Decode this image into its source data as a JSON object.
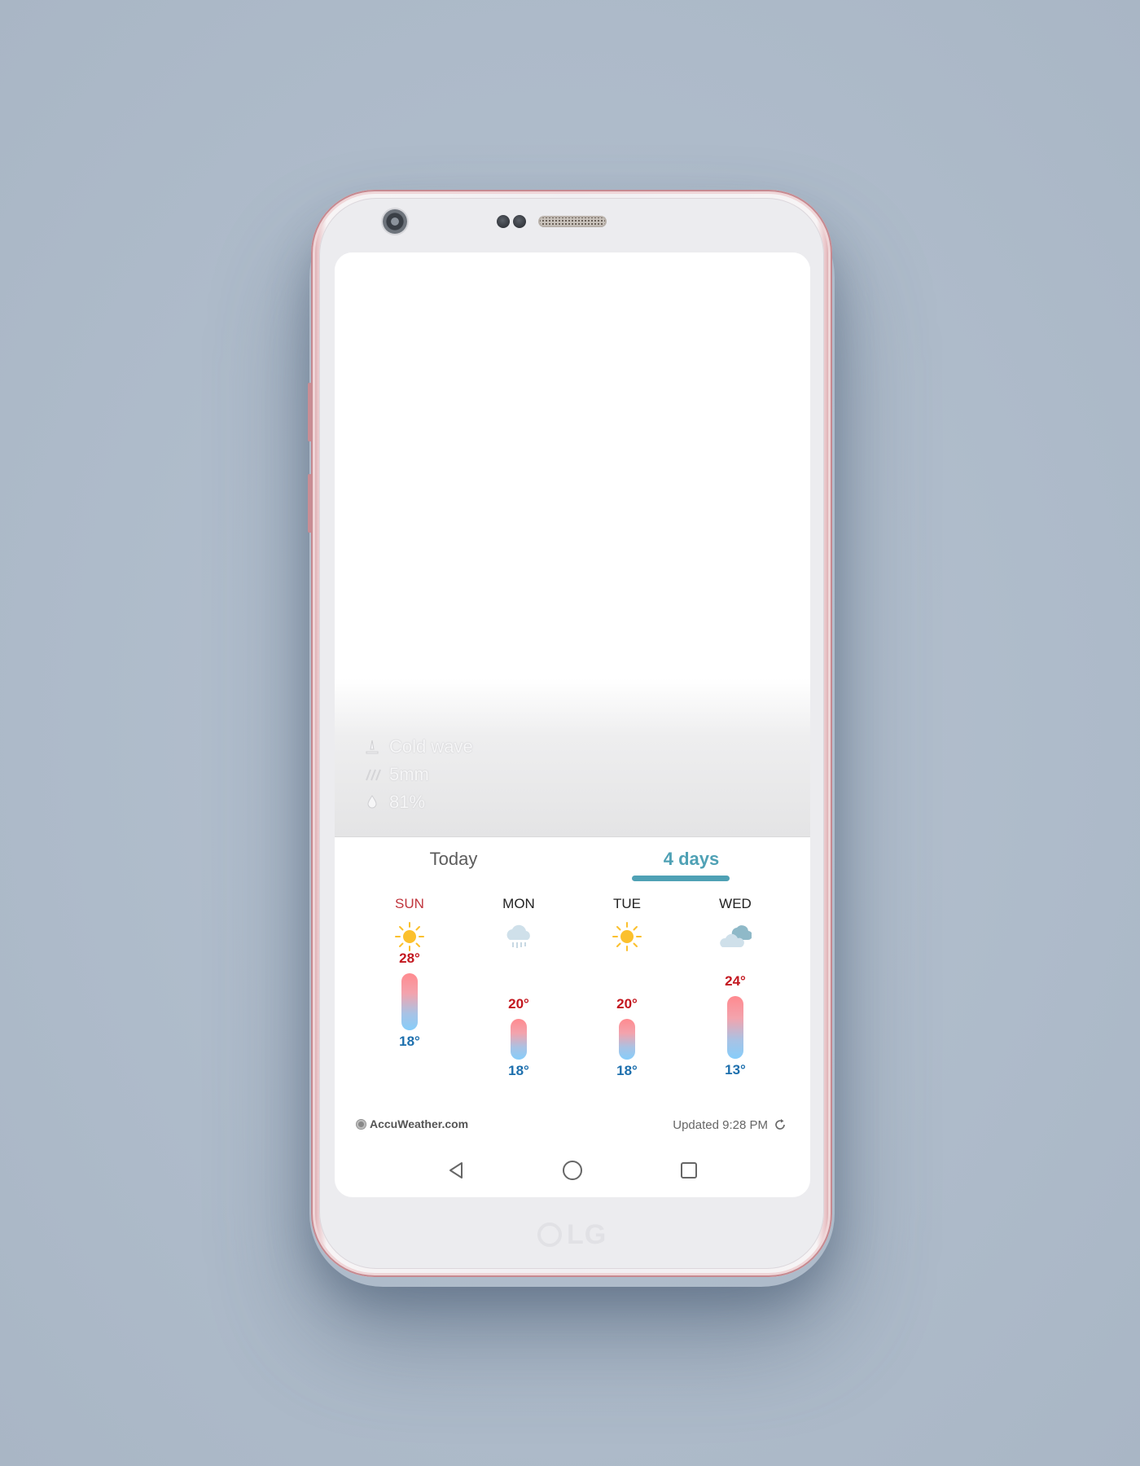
{
  "hero": {
    "details": [
      {
        "icon": "warning-icon",
        "text": "Cold wave"
      },
      {
        "icon": "rain-icon",
        "text": "5mm"
      },
      {
        "icon": "humidity-icon",
        "text": "81%"
      }
    ]
  },
  "tabs": {
    "today": "Today",
    "four_days": "4 days",
    "active": "four_days"
  },
  "forecast": {
    "days": [
      {
        "day": "SUN",
        "icon": "sun-icon",
        "high": "28°",
        "low": "18°",
        "high_val": 28,
        "low_val": 18
      },
      {
        "day": "MON",
        "icon": "rain-cloud-icon",
        "high": "20°",
        "low": "18°",
        "high_val": 20,
        "low_val": 18
      },
      {
        "day": "TUE",
        "icon": "sun-icon",
        "high": "20°",
        "low": "18°",
        "high_val": 20,
        "low_val": 18
      },
      {
        "day": "WED",
        "icon": "cloudy-icon",
        "high": "24°",
        "low": "13°",
        "high_val": 24,
        "low_val": 13
      }
    ]
  },
  "footer": {
    "brand": "AccuWeather.com",
    "updated": "Updated 9:28 PM"
  },
  "colors": {
    "accent": "#4fa1b5",
    "high_temp": "#c3171f",
    "low_temp": "#1d6fad",
    "sunday": "#c0353d"
  }
}
